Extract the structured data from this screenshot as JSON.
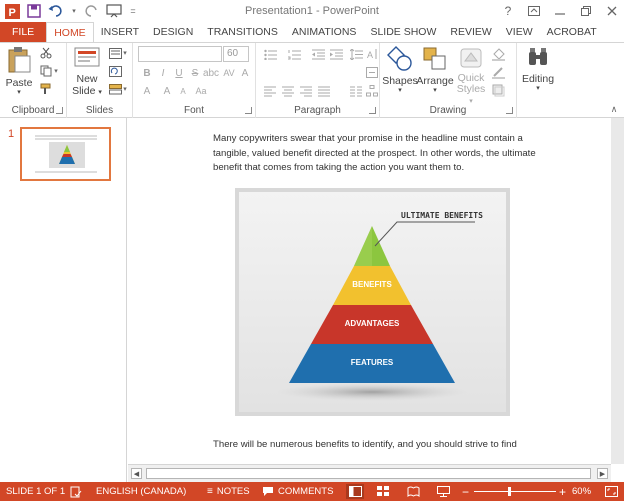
{
  "app": {
    "window_title": "Presentation1 - PowerPoint"
  },
  "ribbon_tabs": [
    "FILE",
    "HOME",
    "INSERT",
    "DESIGN",
    "TRANSITIONS",
    "ANIMATIONS",
    "SLIDE SHOW",
    "REVIEW",
    "VIEW",
    "ACROBAT"
  ],
  "ribbon": {
    "clipboard": {
      "paste_label": "Paste",
      "group_label": "Clipboard"
    },
    "slides": {
      "new_slide_line1": "New",
      "new_slide_line2": "Slide",
      "group_label": "Slides"
    },
    "font": {
      "font_size": "60",
      "group_label": "Font"
    },
    "paragraph": {
      "group_label": "Paragraph"
    },
    "drawing": {
      "shapes_label": "Shapes",
      "arrange_label": "Arrange",
      "quick_styles_line1": "Quick",
      "quick_styles_line2": "Styles",
      "group_label": "Drawing"
    },
    "editing": {
      "label": "Editing"
    }
  },
  "slide_pane": {
    "slide_number": "1"
  },
  "slide": {
    "paragraph_top": "Many copywriters swear that your promise in the headline must contain a tangible, valued benefit directed at the prospect. In other words, the ultimate benefit that comes from taking the action you want them to.",
    "paragraph_bottom": "There will be numerous benefits to identify, and you should strive to find",
    "pyramid": {
      "callout": "ULTIMATE BENEFITS",
      "levels": [
        "BENEFITS",
        "ADVANTAGES",
        "FEATURES"
      ],
      "colors": {
        "top": "#8cc63f",
        "benefits": "#f2c12e",
        "advantages": "#c8362a",
        "features": "#1f6fae"
      }
    }
  },
  "status_bar": {
    "slide_indicator": "SLIDE 1 OF 1",
    "language": "ENGLISH (CANADA)",
    "notes": "NOTES",
    "comments": "COMMENTS",
    "zoom_minus": "−",
    "zoom_plus": "+",
    "zoom_level": "60%",
    "zoom_fraction": 0.42
  },
  "colors": {
    "accent": "#d24726"
  }
}
